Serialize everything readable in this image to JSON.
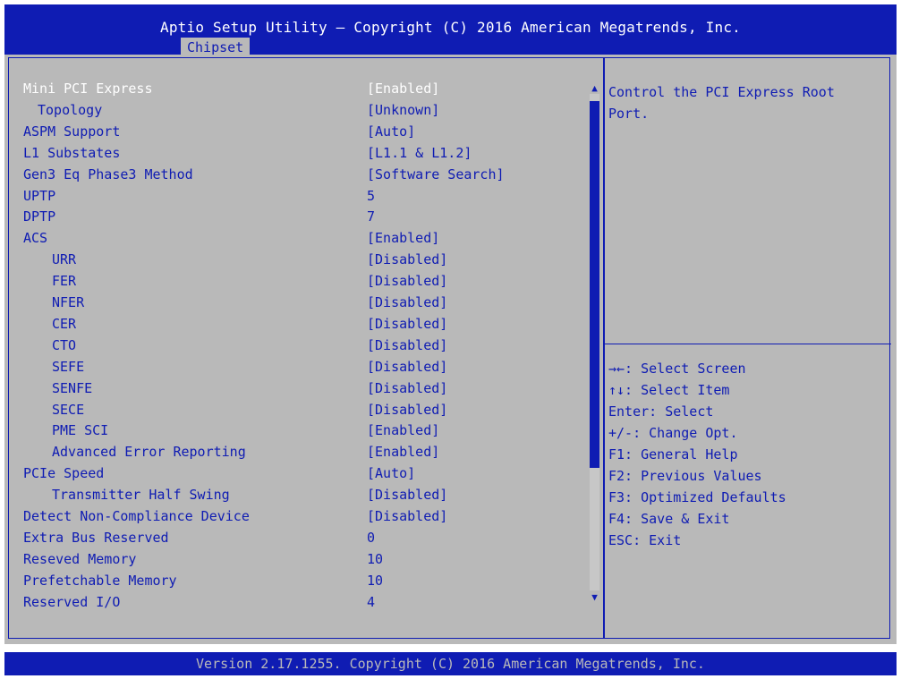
{
  "header": {
    "title": "Aptio Setup Utility – Copyright (C) 2016 American Megatrends, Inc.",
    "active_tab": "Chipset"
  },
  "settings": [
    {
      "label": "Mini PCI Express",
      "value": "[Enabled]",
      "indent": 0,
      "selected": true
    },
    {
      "label": "Topology",
      "value": "[Unknown]",
      "indent": 1
    },
    {
      "label": "ASPM Support",
      "value": "[Auto]",
      "indent": 0
    },
    {
      "label": "L1 Substates",
      "value": "[L1.1 & L1.2]",
      "indent": 0
    },
    {
      "label": "Gen3 Eq Phase3 Method",
      "value": "[Software Search]",
      "indent": 0
    },
    {
      "label": "UPTP",
      "value": "5",
      "indent": 0
    },
    {
      "label": "DPTP",
      "value": "7",
      "indent": 0
    },
    {
      "label": "ACS",
      "value": "[Enabled]",
      "indent": 0
    },
    {
      "label": "URR",
      "value": "[Disabled]",
      "indent": 2
    },
    {
      "label": "FER",
      "value": "[Disabled]",
      "indent": 2
    },
    {
      "label": "NFER",
      "value": "[Disabled]",
      "indent": 2
    },
    {
      "label": "CER",
      "value": "[Disabled]",
      "indent": 2
    },
    {
      "label": "CTO",
      "value": "[Disabled]",
      "indent": 2
    },
    {
      "label": "SEFE",
      "value": "[Disabled]",
      "indent": 2
    },
    {
      "label": "SENFE",
      "value": "[Disabled]",
      "indent": 2
    },
    {
      "label": "SECE",
      "value": "[Disabled]",
      "indent": 2
    },
    {
      "label": "PME SCI",
      "value": "[Enabled]",
      "indent": 2
    },
    {
      "label": "Advanced Error Reporting",
      "value": "[Enabled]",
      "indent": 2
    },
    {
      "label": "PCIe Speed",
      "value": "[Auto]",
      "indent": 0
    },
    {
      "label": "Transmitter Half Swing",
      "value": "[Disabled]",
      "indent": 2
    },
    {
      "label": "Detect Non-Compliance Device",
      "value": "[Disabled]",
      "indent": 0
    },
    {
      "label": "Extra Bus Reserved",
      "value": "0",
      "indent": 0
    },
    {
      "label": "Reseved Memory",
      "value": "10",
      "indent": 0
    },
    {
      "label": "Prefetchable Memory",
      "value": "10",
      "indent": 0
    },
    {
      "label": "Reserved I/O",
      "value": "4",
      "indent": 0
    }
  ],
  "help": {
    "description": "Control the PCI Express Root Port.",
    "keys": [
      "→←: Select Screen",
      "↑↓: Select Item",
      "Enter: Select",
      "+/-: Change Opt.",
      "F1: General Help",
      "F2: Previous Values",
      "F3: Optimized Defaults",
      "F4: Save & Exit",
      "ESC: Exit"
    ]
  },
  "scroll": {
    "up_arrow": "▲",
    "down_arrow": "▼"
  },
  "footer": {
    "version": "Version 2.17.1255. Copyright (C) 2016 American Megatrends, Inc."
  },
  "colors": {
    "bios_blue": "#0f1cb3",
    "panel_gray": "#b9b9b9",
    "selected_text": "#ffffff"
  }
}
